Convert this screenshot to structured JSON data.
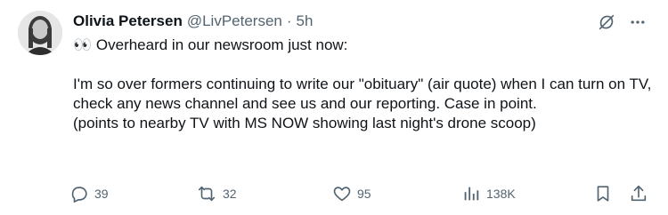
{
  "tweet": {
    "author_name": "Olivia Petersen",
    "handle": "@LivPetersen",
    "separator": "·",
    "time": "5h",
    "text": "👀 Overheard in our newsroom just now:\n\nI'm so over formers continuing to write our \"obituary\" (air quote) when I can turn on TV, check any news channel and see us and our reporting. Case in point.\n(points to nearby TV with MS NOW showing last night's drone scoop)"
  },
  "actions": {
    "replies": "39",
    "reposts": "32",
    "likes": "95",
    "views": "138K"
  },
  "icons": {
    "grok": "grok-icon",
    "more": "more-icon",
    "reply": "reply-icon",
    "repost": "repost-icon",
    "like": "heart-icon",
    "views": "views-icon",
    "bookmark": "bookmark-icon",
    "share": "share-icon"
  },
  "colors": {
    "text": "#0f1419",
    "secondary": "#536471",
    "background": "#ffffff"
  }
}
